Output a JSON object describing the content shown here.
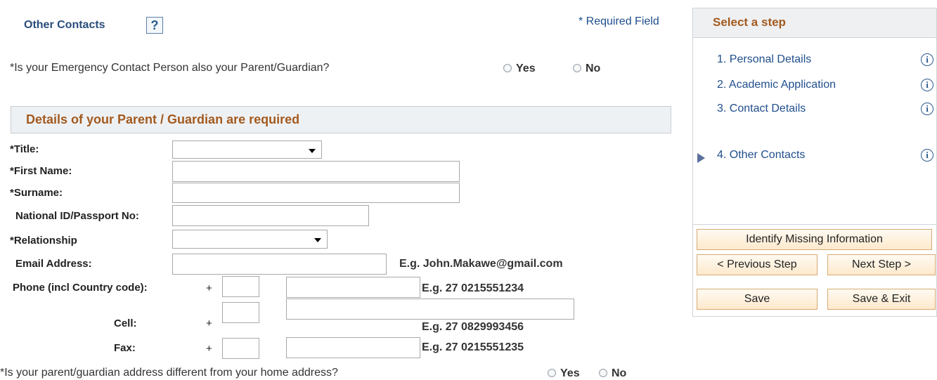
{
  "header": {
    "section_title": "Other Contacts",
    "help_glyph": "?",
    "required_note": "* Required Field"
  },
  "emergency_question": {
    "text": "*Is your Emergency Contact Person also your Parent/Guardian?",
    "yes": "Yes",
    "no": "No"
  },
  "details_panel": {
    "title": "Details of your Parent / Guardian are required"
  },
  "form": {
    "title_label": "*Title:",
    "title_value": "",
    "first_name_label": "*First Name:",
    "first_name_value": "",
    "surname_label": "*Surname:",
    "surname_value": "",
    "national_id_label": "National ID/Passport No:",
    "national_id_value": "",
    "relationship_label": "*Relationship",
    "relationship_value": "",
    "email_label": "Email Address:",
    "email_value": "",
    "email_example": "E.g. John.Makawe@gmail.com",
    "phone_label": "Phone (incl Country code):",
    "phone_example": "E.g.  27 0215551234",
    "cell_label": "Cell:",
    "cell_example": "E.g.  27 0829993456",
    "fax_label": "Fax:",
    "fax_example": "E.g.  27 0215551235",
    "plus": "+"
  },
  "address_question": {
    "text": "*Is your parent/guardian address different from your home address?",
    "yes": "Yes",
    "no": "No"
  },
  "steps": {
    "title": "Select a step",
    "items": [
      {
        "label": "1. Personal Details"
      },
      {
        "label": "2. Academic Application"
      },
      {
        "label": "3. Contact Details"
      },
      {
        "label": "4. Other Contacts",
        "current": true
      }
    ],
    "info_glyph": "i"
  },
  "buttons": {
    "identify": "Identify Missing Information",
    "previous": "< Previous Step",
    "next": "Next Step >",
    "save": "Save",
    "save_exit": "Save & Exit"
  },
  "colors": {
    "link_blue": "#1f4e8c",
    "heading_orange": "#a35a1f",
    "button_fill": "#fde9cc",
    "button_border": "#d6a972"
  }
}
